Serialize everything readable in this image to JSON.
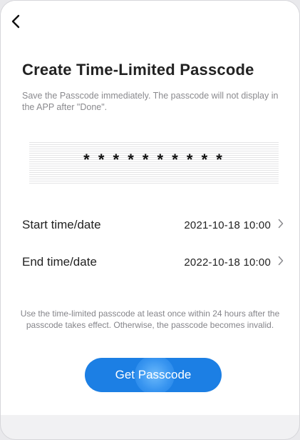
{
  "header": {
    "back_icon": "chevron-left-icon"
  },
  "page": {
    "title": "Create Time-Limited Passcode",
    "subtitle": "Save the  Passcode  immediately. The passcode will not display in the APP after \"Done\"."
  },
  "passcode": {
    "masked_value": "* * * * * * * * * *"
  },
  "rows": [
    {
      "label": "Start time/date",
      "value": "2021-10-18 10:00",
      "icon": "chevron-right-icon"
    },
    {
      "label": "End time/date",
      "value": "2022-10-18 10:00",
      "icon": "chevron-right-icon"
    }
  ],
  "note": "Use the time-limited passcode at least once within 24 hours after the passcode takes effect. Otherwise, the passcode becomes invalid.",
  "action": {
    "button_label": "Get Passcode",
    "color": "#1c7fe4"
  }
}
